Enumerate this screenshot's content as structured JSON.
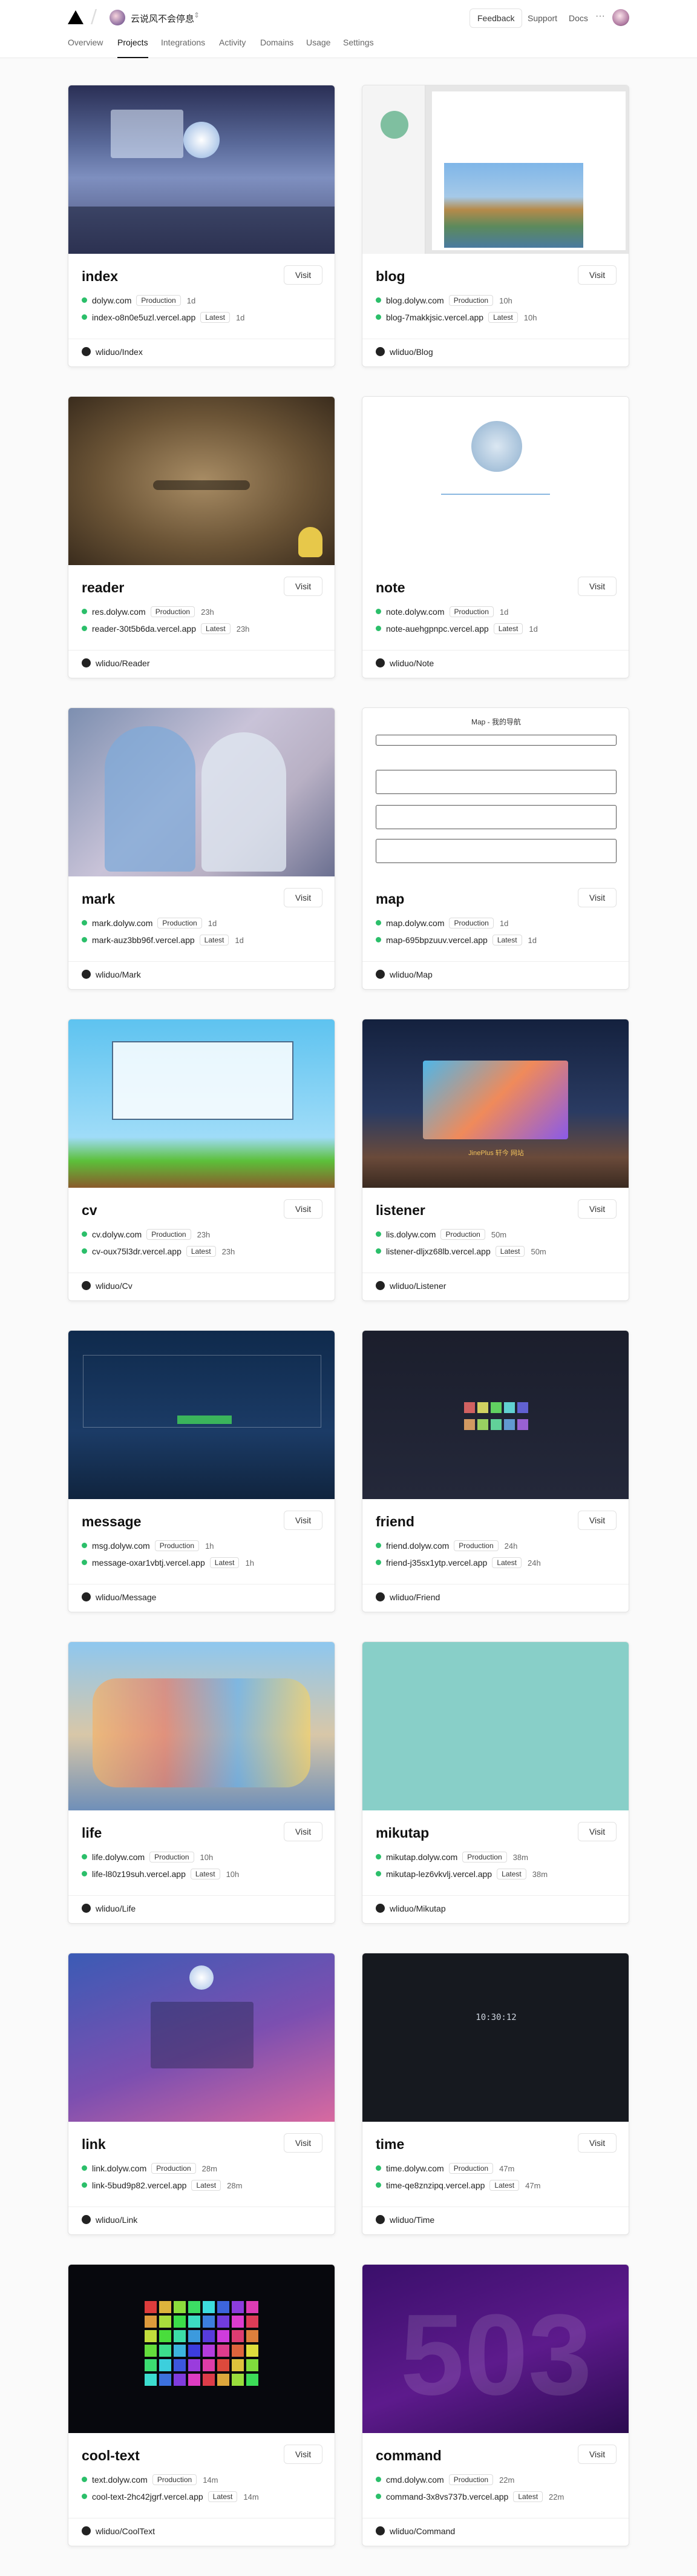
{
  "header": {
    "team_name": "云说风不会停息",
    "team_switch_icon": "chevron-updown-icon",
    "feedback_label": "Feedback",
    "support_label": "Support",
    "docs_label": "Docs",
    "more_label": "···"
  },
  "tabs": [
    {
      "label": "Overview",
      "active": false
    },
    {
      "label": "Projects",
      "active": true
    },
    {
      "label": "Integrations",
      "active": false
    },
    {
      "label": "Activity",
      "active": false
    },
    {
      "label": "Domains",
      "active": false
    },
    {
      "label": "Usage",
      "active": false
    },
    {
      "label": "Settings",
      "active": false
    }
  ],
  "visit_label": "Visit",
  "projects": [
    {
      "name": "index",
      "prod_domain": "dolyw.com",
      "prod_badge": "Production",
      "prod_age": "1d",
      "preview_domain": "index-o8n0e5uzl.vercel.app",
      "preview_badge": "Latest",
      "preview_age": "1d",
      "repo": "wliduo/Index"
    },
    {
      "name": "blog",
      "prod_domain": "blog.dolyw.com",
      "prod_badge": "Production",
      "prod_age": "10h",
      "preview_domain": "blog-7makkjsic.vercel.app",
      "preview_badge": "Latest",
      "preview_age": "10h",
      "repo": "wliduo/Blog"
    },
    {
      "name": "reader",
      "prod_domain": "res.dolyw.com",
      "prod_badge": "Production",
      "prod_age": "23h",
      "preview_domain": "reader-30t5b6da.vercel.app",
      "preview_badge": "Latest",
      "preview_age": "23h",
      "repo": "wliduo/Reader"
    },
    {
      "name": "note",
      "prod_domain": "note.dolyw.com",
      "prod_badge": "Production",
      "prod_age": "1d",
      "preview_domain": "note-auehgpnpc.vercel.app",
      "preview_badge": "Latest",
      "preview_age": "1d",
      "repo": "wliduo/Note"
    },
    {
      "name": "mark",
      "prod_domain": "mark.dolyw.com",
      "prod_badge": "Production",
      "prod_age": "1d",
      "preview_domain": "mark-auz3bb96f.vercel.app",
      "preview_badge": "Latest",
      "preview_age": "1d",
      "repo": "wliduo/Mark"
    },
    {
      "name": "map",
      "prod_domain": "map.dolyw.com",
      "prod_badge": "Production",
      "prod_age": "1d",
      "preview_domain": "map-695bpzuuv.vercel.app",
      "preview_badge": "Latest",
      "preview_age": "1d",
      "repo": "wliduo/Map"
    },
    {
      "name": "cv",
      "prod_domain": "cv.dolyw.com",
      "prod_badge": "Production",
      "prod_age": "23h",
      "preview_domain": "cv-oux75l3dr.vercel.app",
      "preview_badge": "Latest",
      "preview_age": "23h",
      "repo": "wliduo/Cv"
    },
    {
      "name": "listener",
      "prod_domain": "lis.dolyw.com",
      "prod_badge": "Production",
      "prod_age": "50m",
      "preview_domain": "listener-dljxz68lb.vercel.app",
      "preview_badge": "Latest",
      "preview_age": "50m",
      "repo": "wliduo/Listener"
    },
    {
      "name": "message",
      "prod_domain": "msg.dolyw.com",
      "prod_badge": "Production",
      "prod_age": "1h",
      "preview_domain": "message-oxar1vbtj.vercel.app",
      "preview_badge": "Latest",
      "preview_age": "1h",
      "repo": "wliduo/Message"
    },
    {
      "name": "friend",
      "prod_domain": "friend.dolyw.com",
      "prod_badge": "Production",
      "prod_age": "24h",
      "preview_domain": "friend-j35sx1ytp.vercel.app",
      "preview_badge": "Latest",
      "preview_age": "24h",
      "repo": "wliduo/Friend"
    },
    {
      "name": "life",
      "prod_domain": "life.dolyw.com",
      "prod_badge": "Production",
      "prod_age": "10h",
      "preview_domain": "life-l80z19suh.vercel.app",
      "preview_badge": "Latest",
      "preview_age": "10h",
      "repo": "wliduo/Life"
    },
    {
      "name": "mikutap",
      "prod_domain": "mikutap.dolyw.com",
      "prod_badge": "Production",
      "prod_age": "38m",
      "preview_domain": "mikutap-lez6vkvlj.vercel.app",
      "preview_badge": "Latest",
      "preview_age": "38m",
      "repo": "wliduo/Mikutap"
    },
    {
      "name": "link",
      "prod_domain": "link.dolyw.com",
      "prod_badge": "Production",
      "prod_age": "28m",
      "preview_domain": "link-5bud9p82.vercel.app",
      "preview_badge": "Latest",
      "preview_age": "28m",
      "repo": "wliduo/Link"
    },
    {
      "name": "time",
      "prod_domain": "time.dolyw.com",
      "prod_badge": "Production",
      "prod_age": "47m",
      "preview_domain": "time-qe8znzipq.vercel.app",
      "preview_badge": "Latest",
      "preview_age": "47m",
      "repo": "wliduo/Time"
    },
    {
      "name": "cool-text",
      "prod_domain": "text.dolyw.com",
      "prod_badge": "Production",
      "prod_age": "14m",
      "preview_domain": "cool-text-2hc42jgrf.vercel.app",
      "preview_badge": "Latest",
      "preview_age": "14m",
      "repo": "wliduo/CoolText"
    },
    {
      "name": "command",
      "prod_domain": "cmd.dolyw.com",
      "prod_badge": "Production",
      "prod_age": "22m",
      "preview_domain": "command-3x8vs737b.vercel.app",
      "preview_badge": "Latest",
      "preview_age": "22m",
      "repo": "wliduo/Command"
    }
  ],
  "preview_text": {
    "map_title": "Map - 我的导航",
    "listener_title": "JinePlus 轩今 网站",
    "time_clock": "10:30:12",
    "command_code": "503"
  },
  "colors": {
    "ready_dot": "#2bbf6a",
    "accent": "#111111"
  }
}
